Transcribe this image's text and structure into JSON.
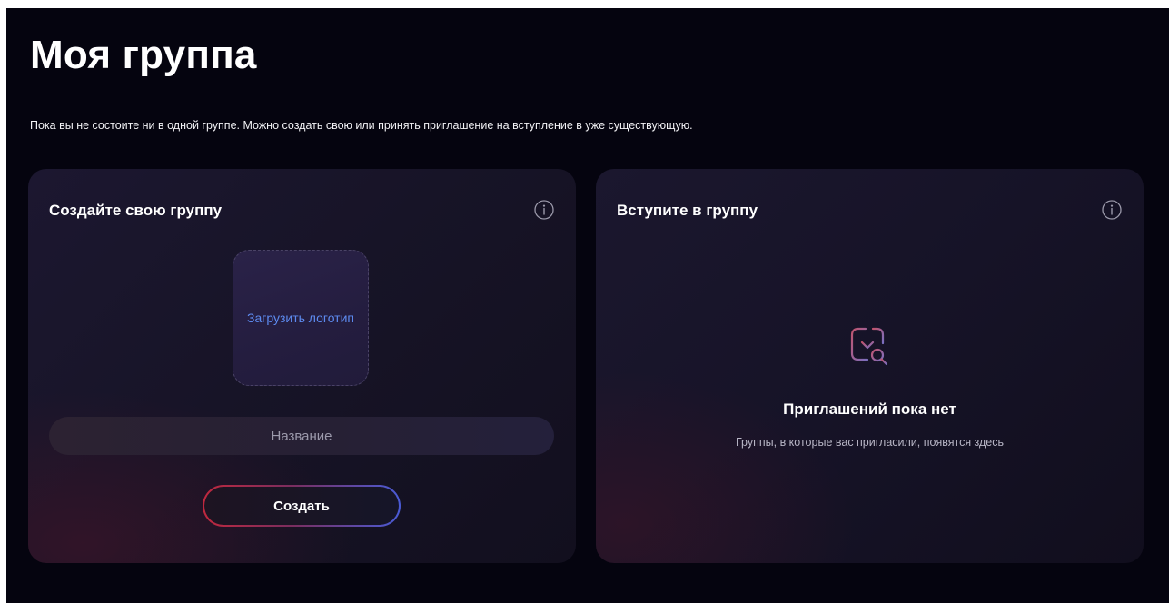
{
  "page": {
    "title": "Моя группа",
    "subtitle": "Пока вы не состоите ни в одной группе. Можно создать свою или принять приглашение на вступление в уже существующую."
  },
  "create_card": {
    "title": "Создайте свою группу",
    "info_icon": "info-icon",
    "upload_logo_label": "Загрузить логотип",
    "name_field": {
      "value": "",
      "placeholder": "Название"
    },
    "create_button_label": "Создать"
  },
  "join_card": {
    "title": "Вступите в группу",
    "info_icon": "info-icon",
    "empty_state": {
      "icon": "invite-search-icon",
      "title": "Приглашений пока нет",
      "description": "Группы, в которые вас пригласили, появятся здесь"
    }
  },
  "colors": {
    "background": "#05040f",
    "card": "#171427",
    "accent_blue": "#5d8bf0",
    "accent_red": "#c0283e",
    "accent_indigo": "#4a5bd6",
    "text_primary": "#ffffff",
    "text_secondary": "#b8b6c6"
  }
}
